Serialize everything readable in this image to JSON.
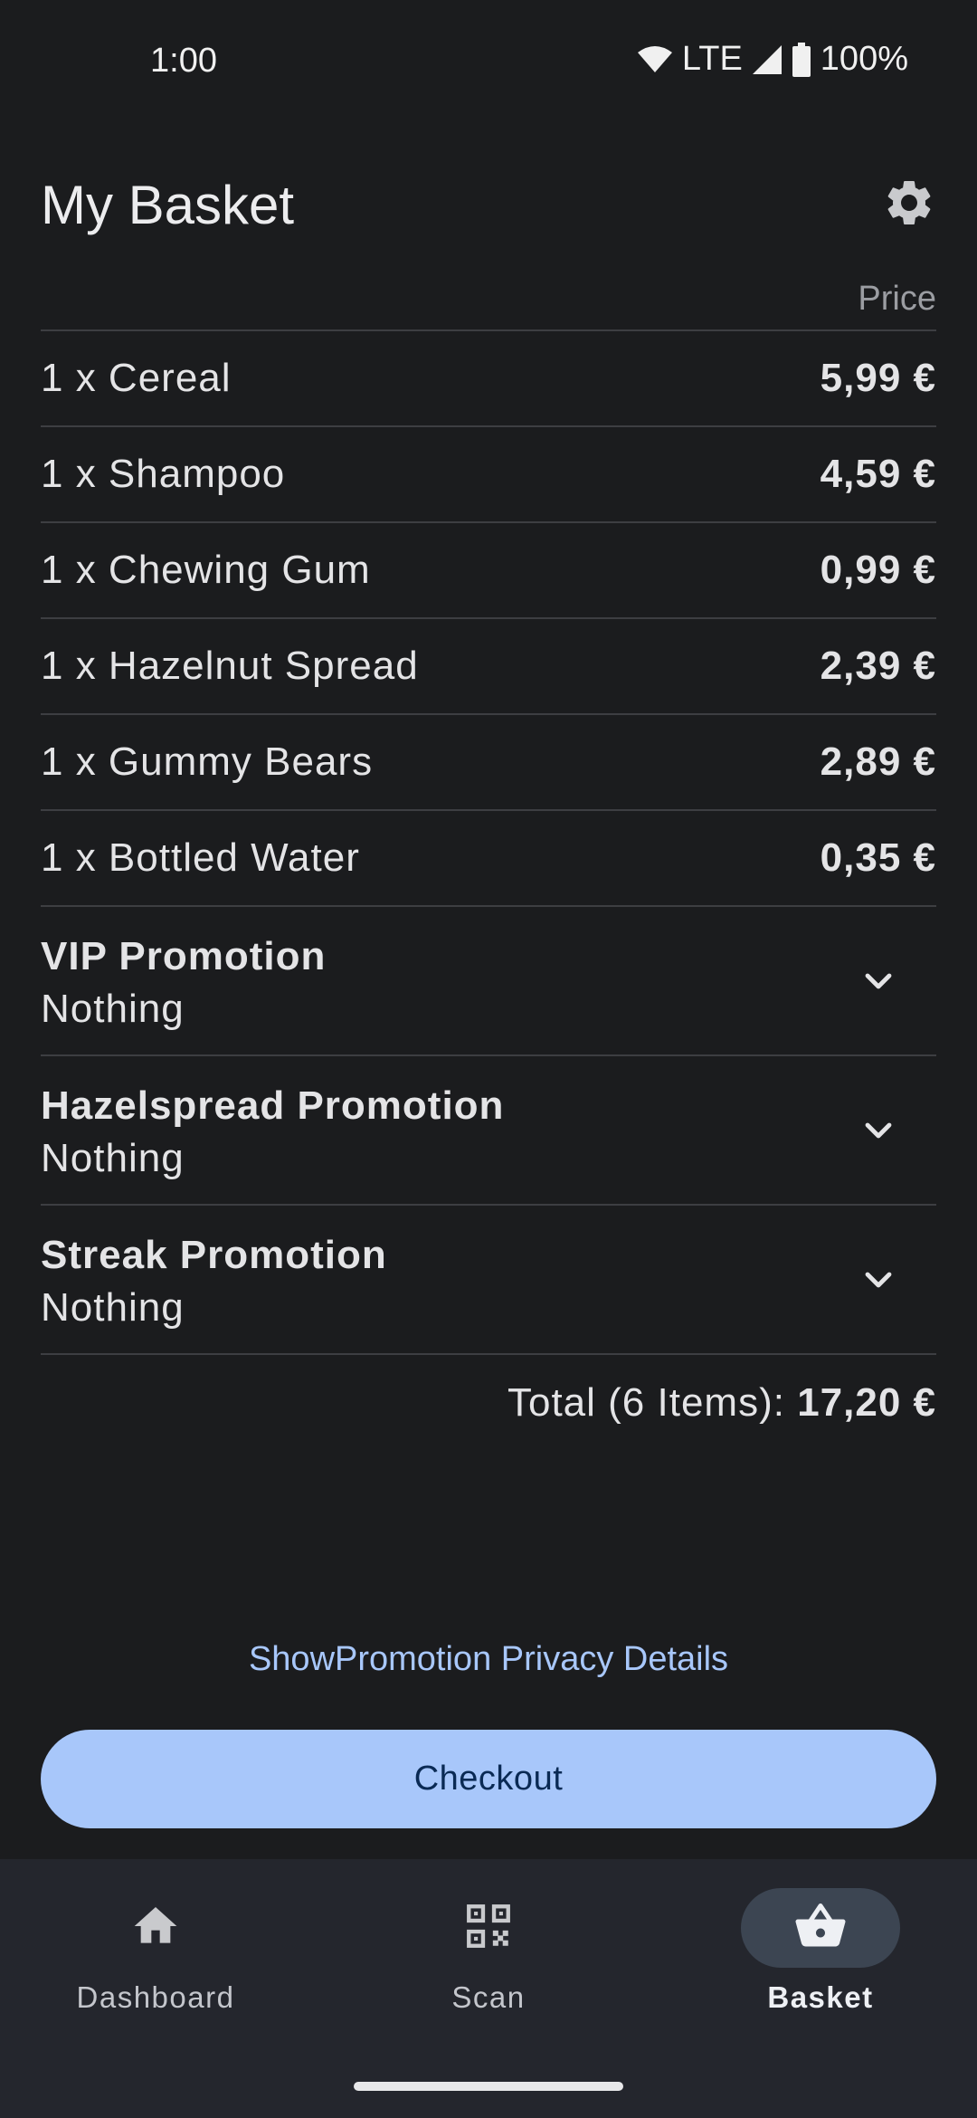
{
  "status_bar": {
    "time": "1:00",
    "network": "LTE",
    "battery": "100%"
  },
  "header": {
    "title": "My Basket",
    "settings_icon": "gear-icon"
  },
  "list": {
    "price_header": "Price",
    "items": [
      {
        "label": "1 x Cereal",
        "price": "5,99 €"
      },
      {
        "label": "1 x Shampoo",
        "price": "4,59 €"
      },
      {
        "label": "1 x Chewing Gum",
        "price": "0,99 €"
      },
      {
        "label": "1 x Hazelnut Spread",
        "price": "2,39 €"
      },
      {
        "label": "1 x Gummy Bears",
        "price": "2,89 €"
      },
      {
        "label": "1 x Bottled Water",
        "price": "0,35 €"
      }
    ],
    "promotions": [
      {
        "title": "VIP Promotion",
        "value": "Nothing"
      },
      {
        "title": "Hazelspread Promotion",
        "value": "Nothing"
      },
      {
        "title": "Streak Promotion",
        "value": "Nothing"
      }
    ],
    "total_label": "Total (6 Items):",
    "total_value": "17,20 €"
  },
  "privacy_link": "ShowPromotion Privacy Details",
  "checkout_label": "Checkout",
  "nav": {
    "items": [
      {
        "label": "Dashboard",
        "icon": "home-icon"
      },
      {
        "label": "Scan",
        "icon": "qr-code-icon"
      },
      {
        "label": "Basket",
        "icon": "basket-icon"
      }
    ],
    "active": "Basket"
  },
  "colors": {
    "background": "#1b1c1e",
    "accent": "#a8c7fa",
    "nav_background": "#24262d"
  }
}
